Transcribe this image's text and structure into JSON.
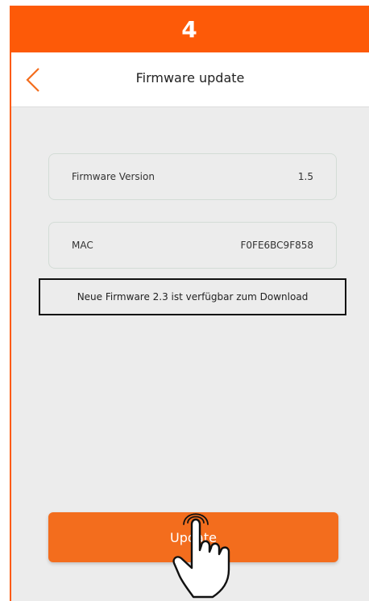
{
  "step": {
    "number": "4"
  },
  "nav": {
    "title": "Firmware update",
    "back_icon": "chevron-left-icon"
  },
  "firmware": {
    "label": "Firmware Version",
    "value": "1.5"
  },
  "mac": {
    "label": "MAC",
    "value": "F0FE6BC9F858"
  },
  "notice": {
    "text": "Neue Firmware 2.3 ist verfügbar zum Download"
  },
  "actions": {
    "update_label": "Update"
  },
  "icons": {
    "pointer": "hand-pointer-icon"
  },
  "colors": {
    "accent": "#fd5a08",
    "button": "#f36d1d",
    "background": "#ececec"
  }
}
